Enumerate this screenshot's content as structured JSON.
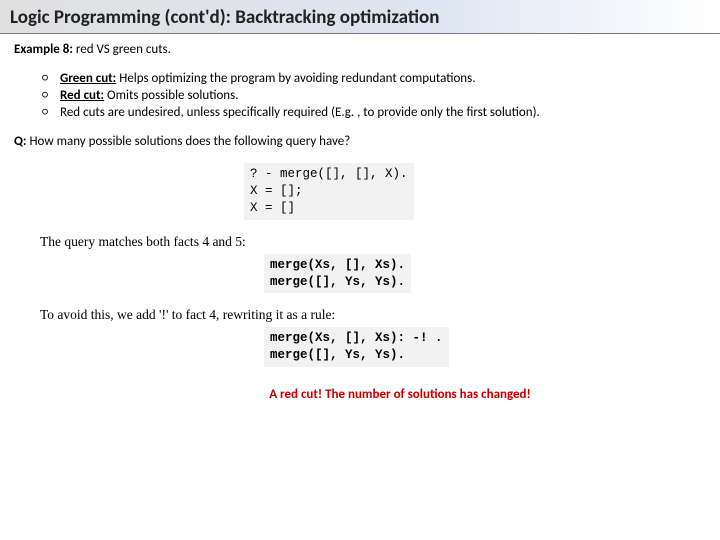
{
  "title": "Logic Programming (cont'd):   Backtracking optimization",
  "example": {
    "label": "Example 8:",
    "text": " red VS green cuts."
  },
  "bullets": [
    {
      "label": "Green cut:",
      "text": " Helps optimizing the program by avoiding redundant computations."
    },
    {
      "label": "Red cut:",
      "text": " Omits possible solutions."
    },
    {
      "label": "",
      "text": "Red cuts are undesired, unless specifically required (E.g. , to provide only the first solution)."
    }
  ],
  "question": {
    "label": "Q:",
    "text": " How many possible solutions does the following query have?"
  },
  "code1": "? - merge([], [], X).\nX = [];\nX = []",
  "para1": "The query matches both facts 4 and 5:",
  "code2": "merge(Xs, [], Xs).\nmerge([], Ys, Ys).",
  "para2": "To avoid this, we add '!' to fact 4, rewriting it as a rule:",
  "code3": "merge(Xs, [], Xs): -! .\nmerge([], Ys, Ys).",
  "red_note": "A red cut! The number of solutions has changed!"
}
